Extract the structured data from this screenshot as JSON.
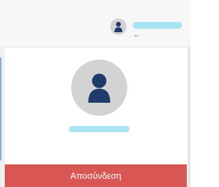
{
  "header": {
    "user_subtitle": "--",
    "avatar_icon": "user-silhouette-icon"
  },
  "user_panel": {
    "avatar_icon": "user-silhouette-icon",
    "logout_label": "Αποσύνδεση"
  },
  "colors": {
    "header_bg": "#f7f7f7",
    "avatar_bg": "#d3d3d3",
    "avatar_figure": "#1f3a6b",
    "redaction": "#a9e4f3",
    "logout_bg": "#d85653",
    "logout_text": "#ffffff"
  }
}
